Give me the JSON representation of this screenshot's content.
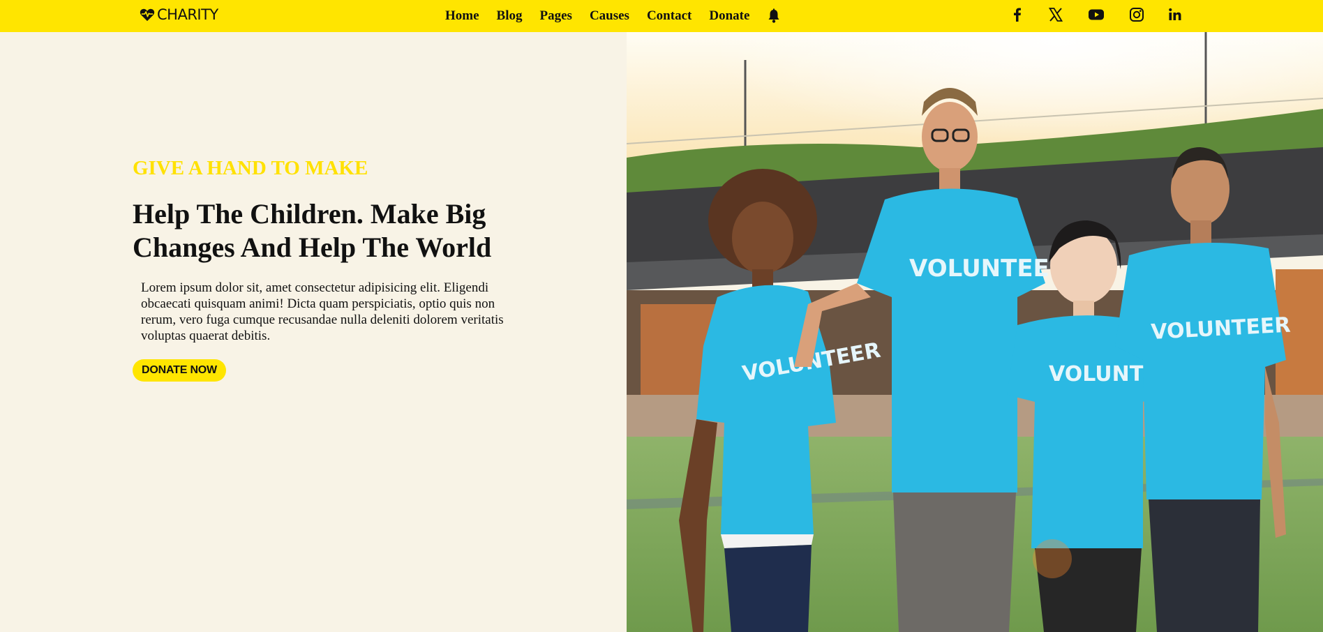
{
  "brand": {
    "name": "CHARITY",
    "logo_icon": "heart-pulse-icon"
  },
  "nav": {
    "items": [
      "Home",
      "Blog",
      "Pages",
      "Causes",
      "Contact",
      "Donate"
    ],
    "notification_icon": "bell-icon"
  },
  "socials": [
    "facebook-icon",
    "x-twitter-icon",
    "youtube-icon",
    "instagram-icon",
    "linkedin-icon"
  ],
  "hero": {
    "eyebrow": "GIVE A HAND TO MAKE",
    "headline": "Help The Children. Make Big Changes And Help The World",
    "description": "Lorem ipsum dolor sit, amet consectetur adipisicing elit. Eligendi obcaecati quisquam animi! Dicta quam perspiciatis, optio quis non rerum, vero fuga cumque recusandae nulla deleniti dolorem veritatis voluptas quaerat debitis.",
    "cta_label": "DONATE NOW",
    "image_shirt_text": "VOLUNTEER"
  },
  "colors": {
    "accent": "#ffe500",
    "background": "#f8f3e6",
    "text": "#111111",
    "shirt": "#2bb9e3"
  }
}
